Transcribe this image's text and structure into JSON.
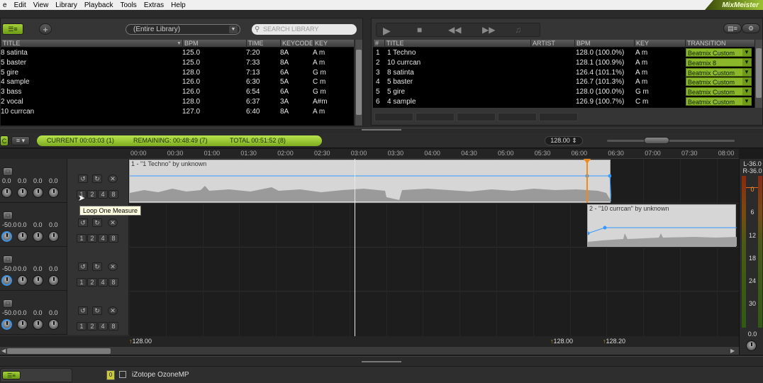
{
  "menu": [
    "e",
    "Edit",
    "View",
    "Library",
    "Playback",
    "Tools",
    "Extras",
    "Help"
  ],
  "brand": "MixMeister",
  "library": {
    "filter": "(Entire Library)",
    "search_placeholder": "SEARCH LIBRARY",
    "columns": [
      "TITLE",
      "BPM",
      "TIME",
      "KEYCODE",
      "KEY"
    ],
    "rows": [
      [
        "8 satinta",
        "125.0",
        "7:20",
        "8A",
        "A m"
      ],
      [
        "5 baster",
        "125.0",
        "7:33",
        "8A",
        "A m"
      ],
      [
        "5 gire",
        "128.0",
        "7:13",
        "6A",
        "G m"
      ],
      [
        "4 sample",
        "126.0",
        "6:30",
        "5A",
        "C m"
      ],
      [
        "3 bass",
        "126.0",
        "6:54",
        "6A",
        "G m"
      ],
      [
        "2 vocal",
        "128.0",
        "6:37",
        "3A",
        "A#m"
      ],
      [
        "10 currcan",
        "127.0",
        "6:40",
        "8A",
        "A m"
      ]
    ]
  },
  "playlist": {
    "columns": [
      "#",
      "TITLE",
      "ARTIST",
      "BPM",
      "KEY",
      "TRANSITION"
    ],
    "rows": [
      [
        "1",
        "1 Techno",
        "",
        "128.0 (100.0%)",
        "A m",
        "Beatmix Custom"
      ],
      [
        "2",
        "10 currcan",
        "",
        "128.1 (100.9%)",
        "A m",
        "Beatmix 8"
      ],
      [
        "3",
        "8 satinta",
        "",
        "126.4 (101.1%)",
        "A m",
        "Beatmix Custom"
      ],
      [
        "4",
        "5 baster",
        "",
        "126.7 (101.3%)",
        "A m",
        "Beatmix Custom"
      ],
      [
        "5",
        "5 gire",
        "",
        "128.0 (100.0%)",
        "G m",
        "Beatmix Custom"
      ],
      [
        "6",
        "4 sample",
        "",
        "126.9 (100.7%)",
        "C m",
        "Beatmix Custom"
      ]
    ]
  },
  "status": {
    "current": "CURRENT 00:03:03 (1)",
    "remaining": "REMAINING: 00:48:49 (7)",
    "total": "TOTAL 00:51:52 (8)"
  },
  "tempo": "128.00",
  "ruler": [
    "00:00",
    "00:30",
    "01:00",
    "01:30",
    "02:00",
    "02:30",
    "03:00",
    "03:30",
    "04:00",
    "04:30",
    "05:00",
    "05:30",
    "06:00",
    "06:30",
    "07:00",
    "07:30",
    "08:00"
  ],
  "tracks": [
    {
      "vals": [
        "0.0",
        "0.0",
        "0.0",
        "0.0"
      ]
    },
    {
      "vals": [
        "-50.0",
        "0.0",
        "0.0",
        "0.0"
      ]
    },
    {
      "vals": [
        "-50.0",
        "0.0",
        "0.0",
        "0.0"
      ]
    },
    {
      "vals": [
        "-50.0",
        "0.0",
        "0.0",
        "0.0"
      ]
    }
  ],
  "loop_labels": [
    "1",
    "2",
    "4",
    "8"
  ],
  "tooltip": "Loop One Measure",
  "clips": [
    {
      "title": "1 - \"1 Techno\" by unknown"
    },
    {
      "title": "2 - \"10 currcan\" by unknown"
    }
  ],
  "bpm_markers": [
    "128.00",
    "128.00",
    "128.20"
  ],
  "vu": {
    "left": "L-36.0",
    "right": "R-36.0",
    "scale": [
      "0",
      "6",
      "12",
      "18",
      "24",
      "30"
    ],
    "bottom": "0.0"
  },
  "plugin": "iZotope OzoneMP",
  "colors": {
    "accent": "#8ab82a",
    "highlight": "#3399ff",
    "clip": "#d6d6d6"
  }
}
